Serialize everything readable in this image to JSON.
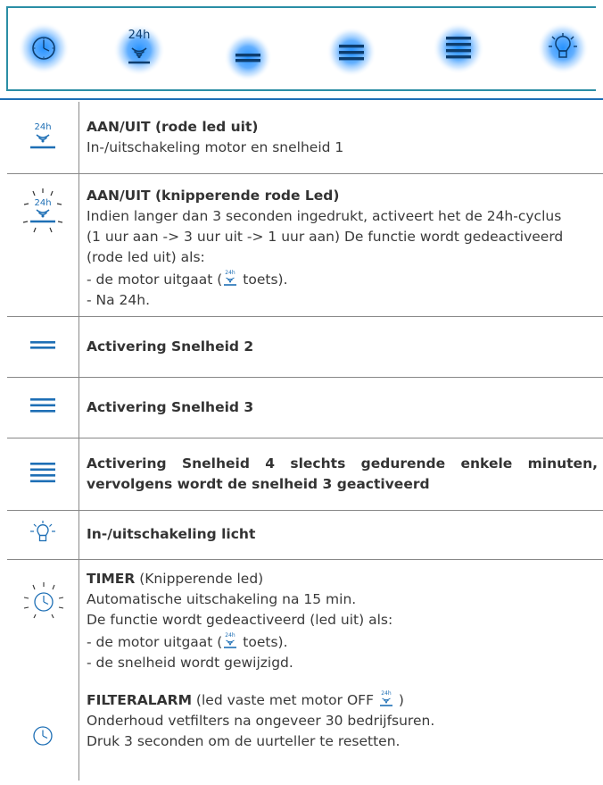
{
  "panel_buttons": [
    {
      "icon": "timer-icon"
    },
    {
      "icon": "power-24h-icon",
      "label": "24h"
    },
    {
      "icon": "speed-2-icon"
    },
    {
      "icon": "speed-3-icon"
    },
    {
      "icon": "speed-4-icon"
    },
    {
      "icon": "light-icon"
    }
  ],
  "rows": [
    {
      "icon": "power-24h-icon",
      "icon_label": "24h",
      "title": "AAN/UIT (rode led uit)",
      "desc": "In-/uitschakeling motor en snelheid 1"
    },
    {
      "icon": "power-24h-blinking-icon",
      "icon_label": "24h",
      "title": "AAN/UIT (knipperende rode Led)",
      "lines": [
        "Indien langer dan 3 seconden ingedrukt, activeert het de 24h-cyclus",
        "(1 uur aan -> 3 uur uit -> 1 uur aan) De functie wordt gedeactiveerd",
        "(rode led uit) als:"
      ],
      "motor_pre": "- de motor uitgaat (",
      "motor_post": " toets).",
      "after_24h": "- Na 24h."
    },
    {
      "icon": "speed-2-icon",
      "title": "Activering Snelheid 2"
    },
    {
      "icon": "speed-3-icon",
      "title": "Activering Snelheid 3"
    },
    {
      "icon": "speed-4-icon",
      "title": "Activering Snelheid 4 slechts gedurende enkele minuten, vervolgens wordt de snelheid 3 geactiveerd"
    },
    {
      "icon": "light-icon",
      "title": "In-/uitschakeling licht"
    },
    {
      "icon": "timer-blinking-icon",
      "title": "TIMER",
      "title_suffix": " (Knipperende led)",
      "line1": "Automatische uitschakeling na 15 min.",
      "line2": "De functie wordt gedeactiveerd (led uit) als:",
      "motor_pre": "- de motor uitgaat (",
      "motor_post": " toets).",
      "line4": "- de snelheid wordt gewijzigd."
    },
    {
      "icon": "timer-icon",
      "title": "FILTERALARM",
      "title_suffix": " (led vaste met motor OFF ",
      "title_end": " )",
      "line1": "Onderhoud vetfilters na ongeveer 30 bedrijfsuren.",
      "line2": "Druk 3 seconden om de uurteller te resetten."
    }
  ],
  "colors": {
    "frame": "#2b8ea5",
    "icon_blue": "#1e6fb5",
    "glow": "#1a8cff",
    "rule": "#1e6fb5"
  }
}
